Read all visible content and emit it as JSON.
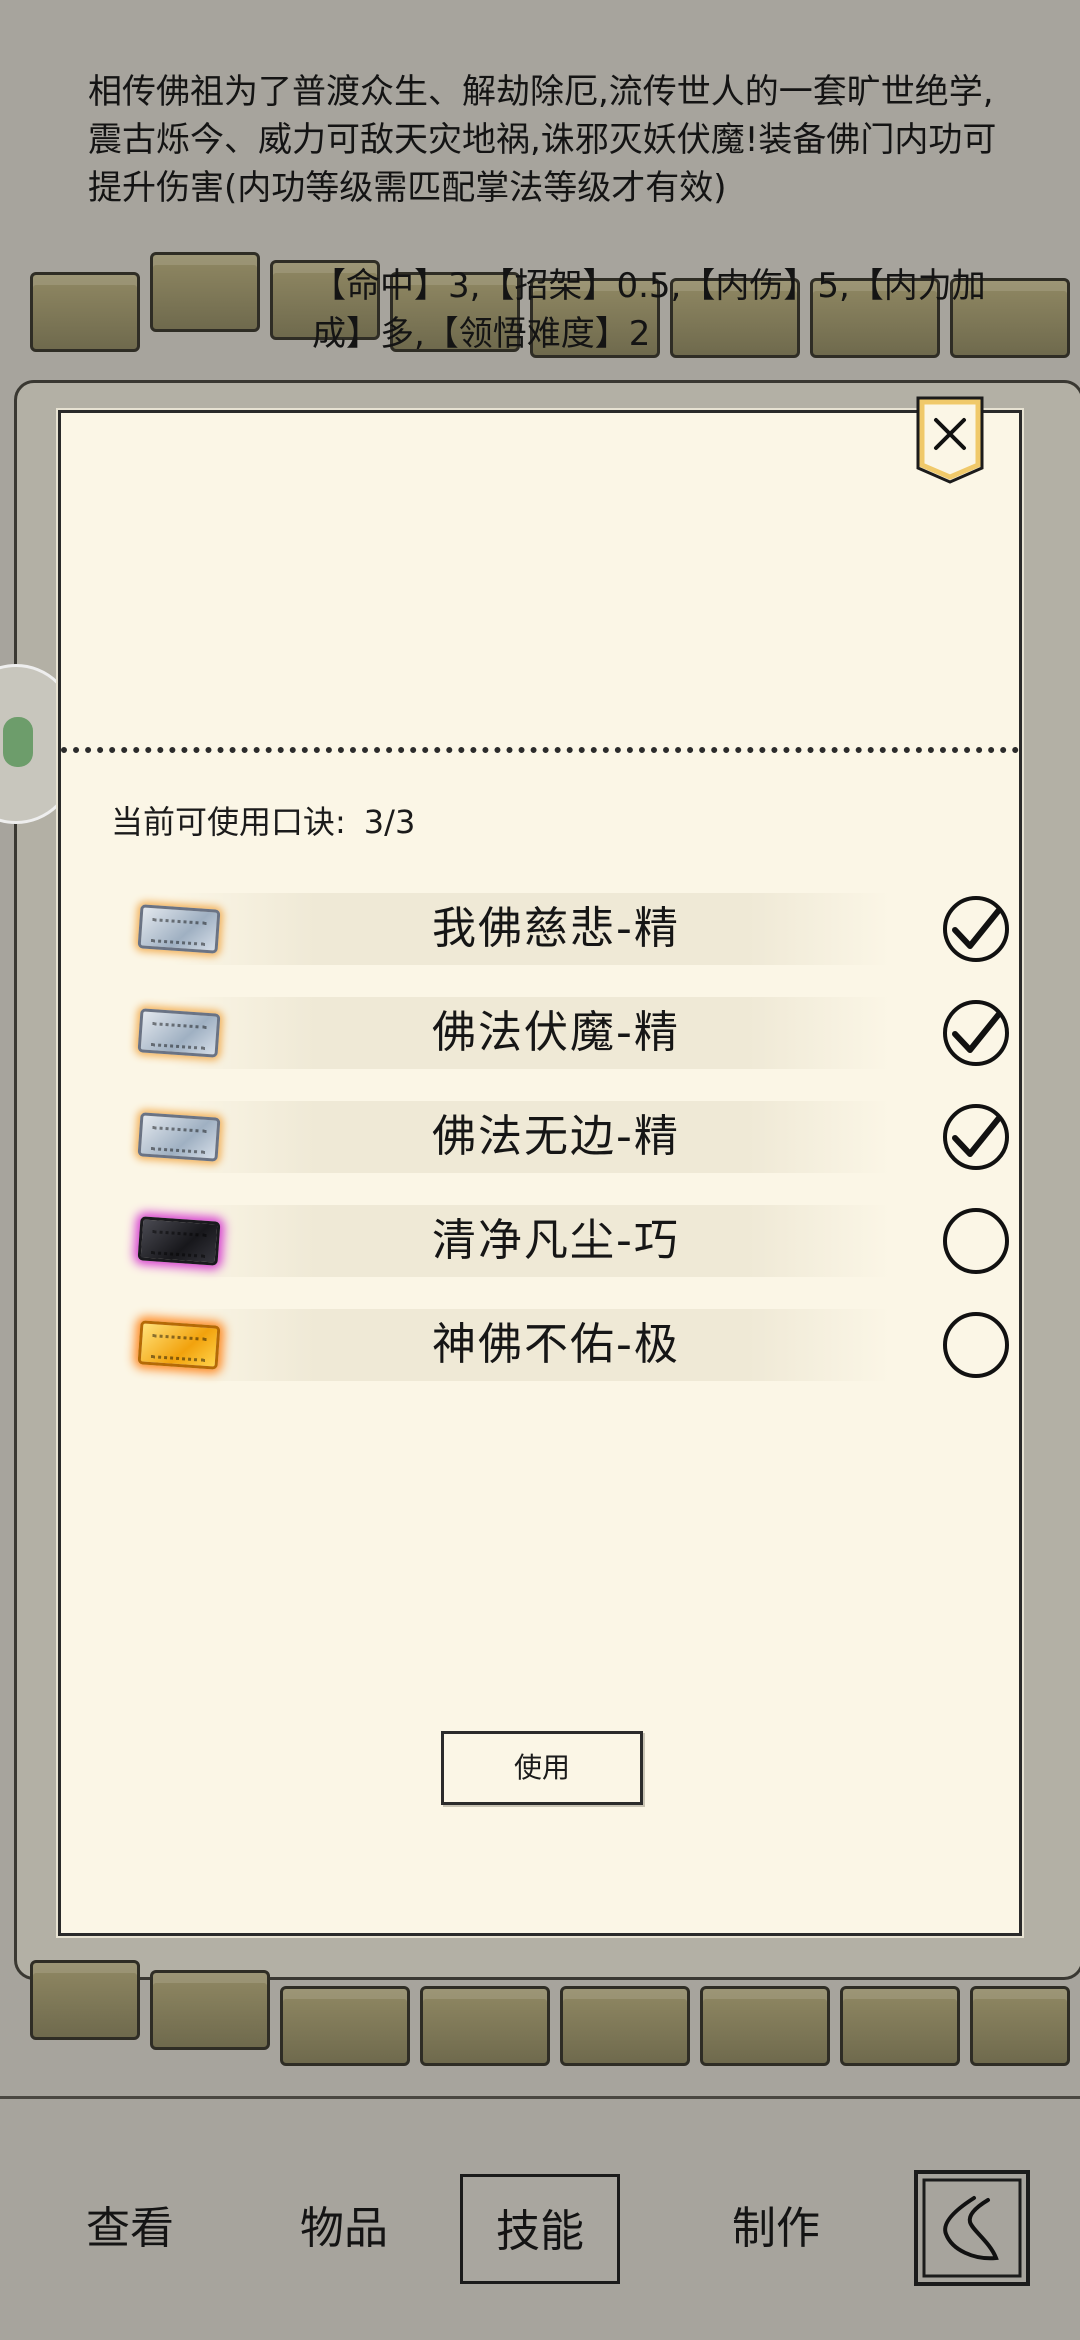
{
  "background": {
    "description": "相传佛祖为了普渡众生、解劫除厄,流传世人的一套旷世绝学,震古烁今、威力可敌天灾地祸,诛邪灭妖伏魔!装备佛门内功可提升伤害(内功等级需匹配掌法等级才有效)",
    "stats": "【命中】3,【招架】0.5,【内伤】5,【内力加成】多,【领悟难度】2"
  },
  "dialog": {
    "count_label": "当前可使用口诀:",
    "count_value": "3/3",
    "options": [
      {
        "label": "我佛慈悲-精",
        "token": "silver-token-icon",
        "checked": true
      },
      {
        "label": "佛法伏魔-精",
        "token": "silver-token-icon",
        "checked": true
      },
      {
        "label": "佛法无边-精",
        "token": "silver-token-icon",
        "checked": true
      },
      {
        "label": "清净凡尘-巧",
        "token": "purple-token-icon",
        "checked": false
      },
      {
        "label": "神佛不佑-极",
        "token": "gold-token-icon",
        "checked": false
      }
    ],
    "use_label": "使用",
    "close_icon": "close-icon"
  },
  "nav": {
    "tabs": [
      {
        "label": "查看",
        "active": false
      },
      {
        "label": "物品",
        "active": false
      },
      {
        "label": "技能",
        "active": true
      },
      {
        "label": "制作",
        "active": false
      }
    ],
    "back_icon": "back-icon"
  },
  "colors": {
    "paper": "#fbf6e6",
    "dim_background": "#a7a49d",
    "ink": "#1b1b1b",
    "silver_glow": "#f2b15a",
    "purple_glow": "#d63dd0",
    "gold": "#f2a20d"
  }
}
